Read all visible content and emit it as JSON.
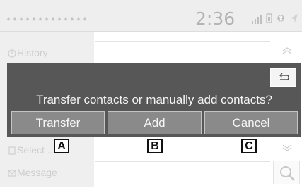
{
  "status_bar": {
    "masked_title": "*************",
    "time": "2:36",
    "signal_icon": "signal-bars-icon",
    "phone_icon": "phone-battery-icon",
    "bluetooth_icon": "bluetooth-icon",
    "arrow_icon": "direction-arrow-icon"
  },
  "background_menu": {
    "items": [
      {
        "label": "History",
        "icon": "clock-icon"
      },
      {
        "label": "Select ...",
        "icon": "phone-icon"
      },
      {
        "label": "Message",
        "icon": "envelope-icon"
      }
    ],
    "search_icon": "search-icon"
  },
  "dialog": {
    "message": "Transfer contacts or manually add contacts?",
    "back_icon": "back-arrow-icon",
    "buttons": [
      {
        "label": "Transfer"
      },
      {
        "label": "Add"
      },
      {
        "label": "Cancel"
      }
    ]
  },
  "callouts": [
    "A",
    "B",
    "C"
  ],
  "colors": {
    "dialog_bg": "#575757",
    "button_bg": "#8a8a8a",
    "button_border": "#c4c4c4",
    "text_light": "#f4f4f4"
  }
}
